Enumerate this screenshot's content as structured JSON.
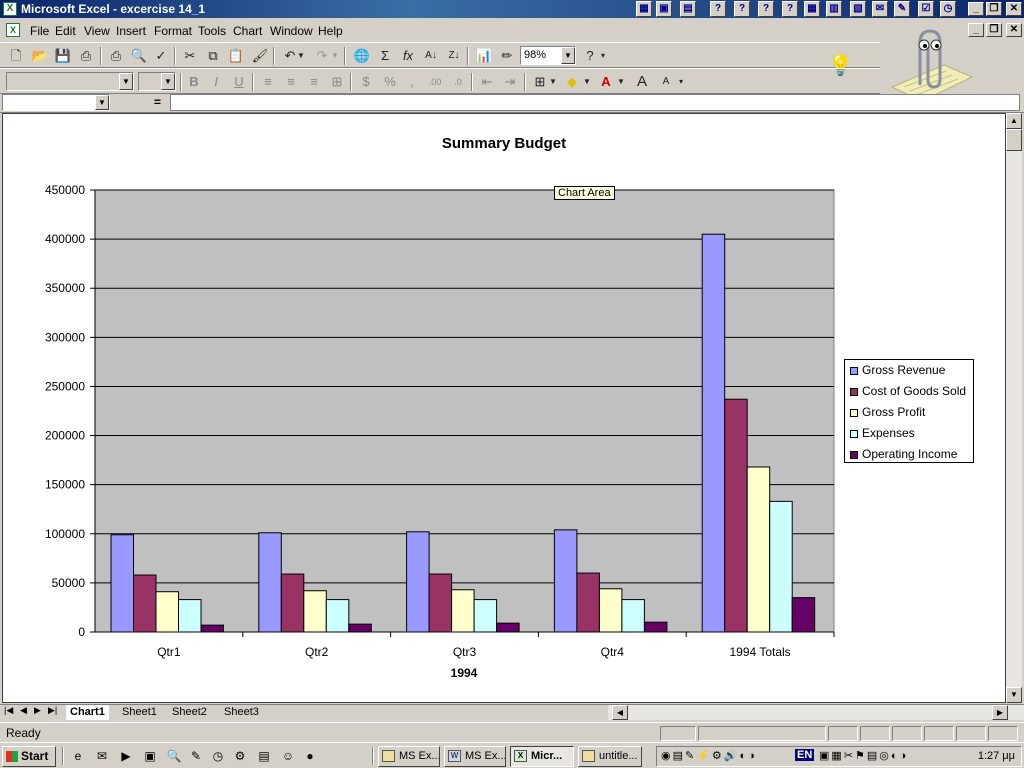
{
  "window": {
    "title": "Microsoft Excel - excercise 14_1",
    "icon": "excel-icon"
  },
  "menu": {
    "items": [
      {
        "label": "File",
        "key": "F"
      },
      {
        "label": "Edit",
        "key": "E"
      },
      {
        "label": "View",
        "key": "V"
      },
      {
        "label": "Insert",
        "key": "I"
      },
      {
        "label": "Format",
        "key": "o"
      },
      {
        "label": "Tools",
        "key": "T"
      },
      {
        "label": "Chart",
        "key": "C"
      },
      {
        "label": "Window",
        "key": "W"
      },
      {
        "label": "Help",
        "key": "H"
      }
    ]
  },
  "toolbar": {
    "zoom": "98%",
    "font_name": "",
    "font_size": ""
  },
  "formula_bar": {
    "name_box": "",
    "equals": "="
  },
  "chart_data": {
    "type": "bar",
    "title": "Summary Budget",
    "xlabel": "1994",
    "ylabel": "",
    "categories": [
      "Qtr1",
      "Qtr2",
      "Qtr3",
      "Qtr4",
      "1994 Totals"
    ],
    "ylim": [
      0,
      450000
    ],
    "yticks": [
      0,
      50000,
      100000,
      150000,
      200000,
      250000,
      300000,
      350000,
      400000,
      450000
    ],
    "ytick_labels": [
      "0",
      "50000",
      "100000",
      "150000",
      "200000",
      "250000",
      "300000",
      "350000",
      "400000",
      "450000"
    ],
    "grid": true,
    "legend": "right",
    "plot_bg": "#c0c0c0",
    "series": [
      {
        "name": "Gross Revenue",
        "color": "#9999ff",
        "values": [
          99000,
          101000,
          102000,
          104000,
          405000
        ]
      },
      {
        "name": "Cost of Goods Sold",
        "color": "#993366",
        "values": [
          58000,
          59000,
          59000,
          60000,
          237000
        ]
      },
      {
        "name": "Gross Profit",
        "color": "#ffffcc",
        "values": [
          41000,
          42000,
          43000,
          44000,
          168000
        ]
      },
      {
        "name": "Expenses",
        "color": "#ccffff",
        "values": [
          33000,
          33000,
          33000,
          33000,
          133000
        ]
      },
      {
        "name": "Operating Income",
        "color": "#660066",
        "values": [
          7000,
          8000,
          9000,
          10000,
          35000
        ]
      }
    ]
  },
  "tooltip": "Chart Area",
  "sheet_tabs": [
    {
      "label": "Chart1",
      "active": true
    },
    {
      "label": "Sheet1",
      "active": false
    },
    {
      "label": "Sheet2",
      "active": false
    },
    {
      "label": "Sheet3",
      "active": false
    }
  ],
  "status": {
    "text": "Ready"
  },
  "taskbar": {
    "start_label": "Start",
    "buttons": [
      {
        "label": "MS Ex...",
        "active": false
      },
      {
        "label": "MS Ex...",
        "active": false
      },
      {
        "label": "Micr...",
        "active": true
      },
      {
        "label": "untitle...",
        "active": false
      }
    ],
    "clock": "1:27 μμ",
    "lang": "EN"
  }
}
